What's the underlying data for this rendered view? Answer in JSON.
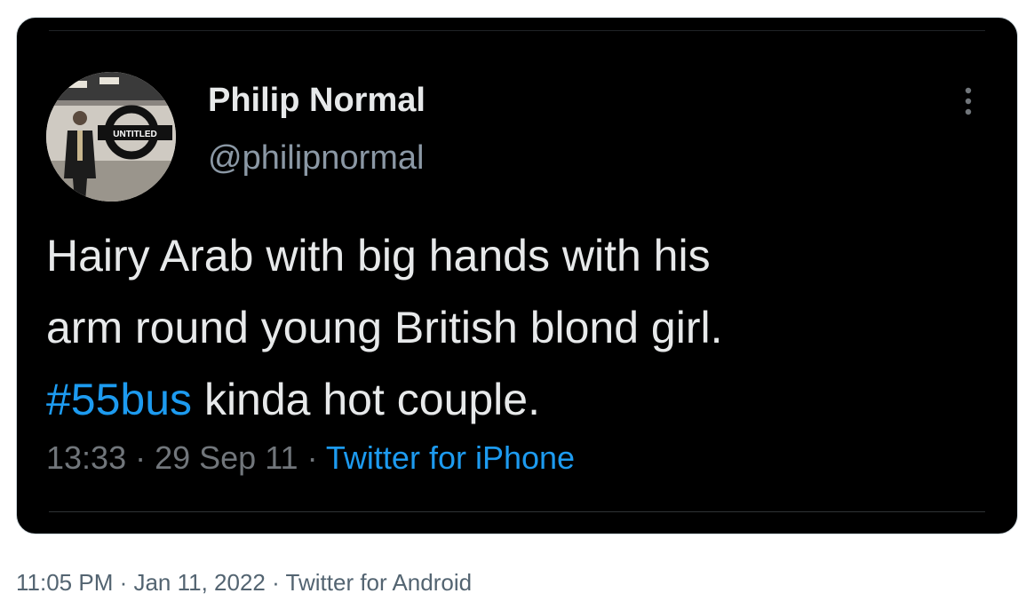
{
  "quoted_tweet": {
    "author": {
      "display_name": "Philip Normal",
      "handle": "@philipnormal",
      "avatar_sign_text": "UNTITLED"
    },
    "text": {
      "line1": "Hairy Arab with big hands with his",
      "line2": "arm round young British blond girl.",
      "hashtag": "#55bus",
      "line3_rest": " kinda hot couple."
    },
    "meta": {
      "time": "13:33",
      "separator": " · ",
      "date": "29 Sep 11",
      "source": "Twitter for iPhone"
    },
    "more_icon": "more-vertical-icon"
  },
  "tweet_meta": {
    "time": "11:05 PM",
    "separator": " · ",
    "date": "Jan 11, 2022",
    "source": "Twitter for Android"
  },
  "colors": {
    "card_bg": "#000000",
    "primary_text": "#e7e9ea",
    "secondary_text": "#71767b",
    "accent": "#1d9bf0",
    "outer_meta": "#536471"
  }
}
